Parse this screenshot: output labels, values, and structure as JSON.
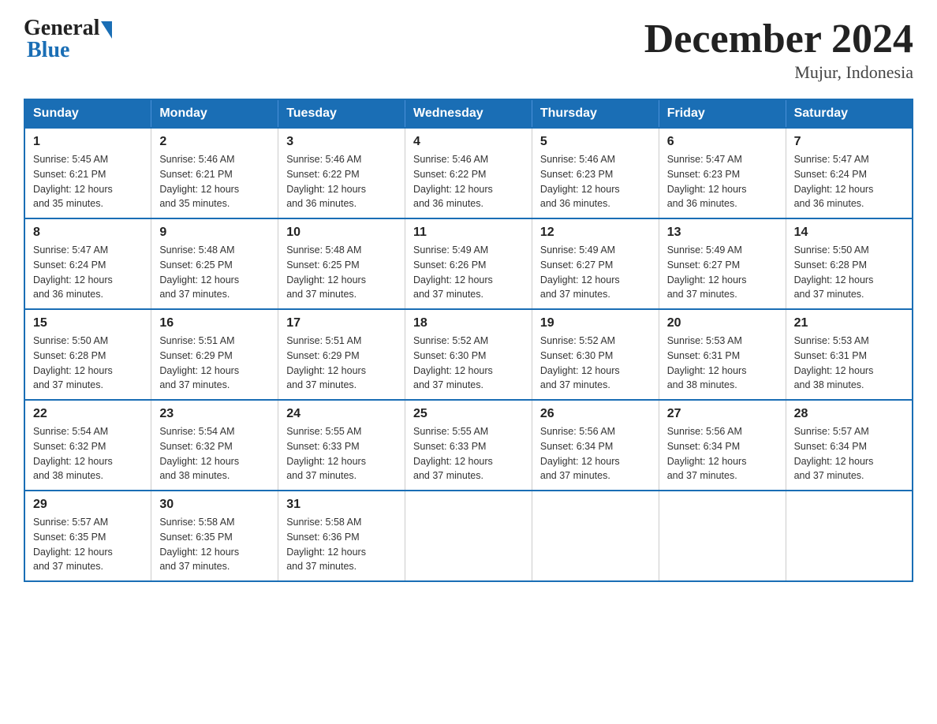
{
  "logo": {
    "general": "General",
    "blue": "Blue"
  },
  "title": "December 2024",
  "location": "Mujur, Indonesia",
  "days_of_week": [
    "Sunday",
    "Monday",
    "Tuesday",
    "Wednesday",
    "Thursday",
    "Friday",
    "Saturday"
  ],
  "weeks": [
    [
      {
        "day": "1",
        "sunrise": "5:45 AM",
        "sunset": "6:21 PM",
        "daylight": "12 hours and 35 minutes."
      },
      {
        "day": "2",
        "sunrise": "5:46 AM",
        "sunset": "6:21 PM",
        "daylight": "12 hours and 35 minutes."
      },
      {
        "day": "3",
        "sunrise": "5:46 AM",
        "sunset": "6:22 PM",
        "daylight": "12 hours and 36 minutes."
      },
      {
        "day": "4",
        "sunrise": "5:46 AM",
        "sunset": "6:22 PM",
        "daylight": "12 hours and 36 minutes."
      },
      {
        "day": "5",
        "sunrise": "5:46 AM",
        "sunset": "6:23 PM",
        "daylight": "12 hours and 36 minutes."
      },
      {
        "day": "6",
        "sunrise": "5:47 AM",
        "sunset": "6:23 PM",
        "daylight": "12 hours and 36 minutes."
      },
      {
        "day": "7",
        "sunrise": "5:47 AM",
        "sunset": "6:24 PM",
        "daylight": "12 hours and 36 minutes."
      }
    ],
    [
      {
        "day": "8",
        "sunrise": "5:47 AM",
        "sunset": "6:24 PM",
        "daylight": "12 hours and 36 minutes."
      },
      {
        "day": "9",
        "sunrise": "5:48 AM",
        "sunset": "6:25 PM",
        "daylight": "12 hours and 37 minutes."
      },
      {
        "day": "10",
        "sunrise": "5:48 AM",
        "sunset": "6:25 PM",
        "daylight": "12 hours and 37 minutes."
      },
      {
        "day": "11",
        "sunrise": "5:49 AM",
        "sunset": "6:26 PM",
        "daylight": "12 hours and 37 minutes."
      },
      {
        "day": "12",
        "sunrise": "5:49 AM",
        "sunset": "6:27 PM",
        "daylight": "12 hours and 37 minutes."
      },
      {
        "day": "13",
        "sunrise": "5:49 AM",
        "sunset": "6:27 PM",
        "daylight": "12 hours and 37 minutes."
      },
      {
        "day": "14",
        "sunrise": "5:50 AM",
        "sunset": "6:28 PM",
        "daylight": "12 hours and 37 minutes."
      }
    ],
    [
      {
        "day": "15",
        "sunrise": "5:50 AM",
        "sunset": "6:28 PM",
        "daylight": "12 hours and 37 minutes."
      },
      {
        "day": "16",
        "sunrise": "5:51 AM",
        "sunset": "6:29 PM",
        "daylight": "12 hours and 37 minutes."
      },
      {
        "day": "17",
        "sunrise": "5:51 AM",
        "sunset": "6:29 PM",
        "daylight": "12 hours and 37 minutes."
      },
      {
        "day": "18",
        "sunrise": "5:52 AM",
        "sunset": "6:30 PM",
        "daylight": "12 hours and 37 minutes."
      },
      {
        "day": "19",
        "sunrise": "5:52 AM",
        "sunset": "6:30 PM",
        "daylight": "12 hours and 37 minutes."
      },
      {
        "day": "20",
        "sunrise": "5:53 AM",
        "sunset": "6:31 PM",
        "daylight": "12 hours and 38 minutes."
      },
      {
        "day": "21",
        "sunrise": "5:53 AM",
        "sunset": "6:31 PM",
        "daylight": "12 hours and 38 minutes."
      }
    ],
    [
      {
        "day": "22",
        "sunrise": "5:54 AM",
        "sunset": "6:32 PM",
        "daylight": "12 hours and 38 minutes."
      },
      {
        "day": "23",
        "sunrise": "5:54 AM",
        "sunset": "6:32 PM",
        "daylight": "12 hours and 38 minutes."
      },
      {
        "day": "24",
        "sunrise": "5:55 AM",
        "sunset": "6:33 PM",
        "daylight": "12 hours and 37 minutes."
      },
      {
        "day": "25",
        "sunrise": "5:55 AM",
        "sunset": "6:33 PM",
        "daylight": "12 hours and 37 minutes."
      },
      {
        "day": "26",
        "sunrise": "5:56 AM",
        "sunset": "6:34 PM",
        "daylight": "12 hours and 37 minutes."
      },
      {
        "day": "27",
        "sunrise": "5:56 AM",
        "sunset": "6:34 PM",
        "daylight": "12 hours and 37 minutes."
      },
      {
        "day": "28",
        "sunrise": "5:57 AM",
        "sunset": "6:34 PM",
        "daylight": "12 hours and 37 minutes."
      }
    ],
    [
      {
        "day": "29",
        "sunrise": "5:57 AM",
        "sunset": "6:35 PM",
        "daylight": "12 hours and 37 minutes."
      },
      {
        "day": "30",
        "sunrise": "5:58 AM",
        "sunset": "6:35 PM",
        "daylight": "12 hours and 37 minutes."
      },
      {
        "day": "31",
        "sunrise": "5:58 AM",
        "sunset": "6:36 PM",
        "daylight": "12 hours and 37 minutes."
      },
      null,
      null,
      null,
      null
    ]
  ]
}
